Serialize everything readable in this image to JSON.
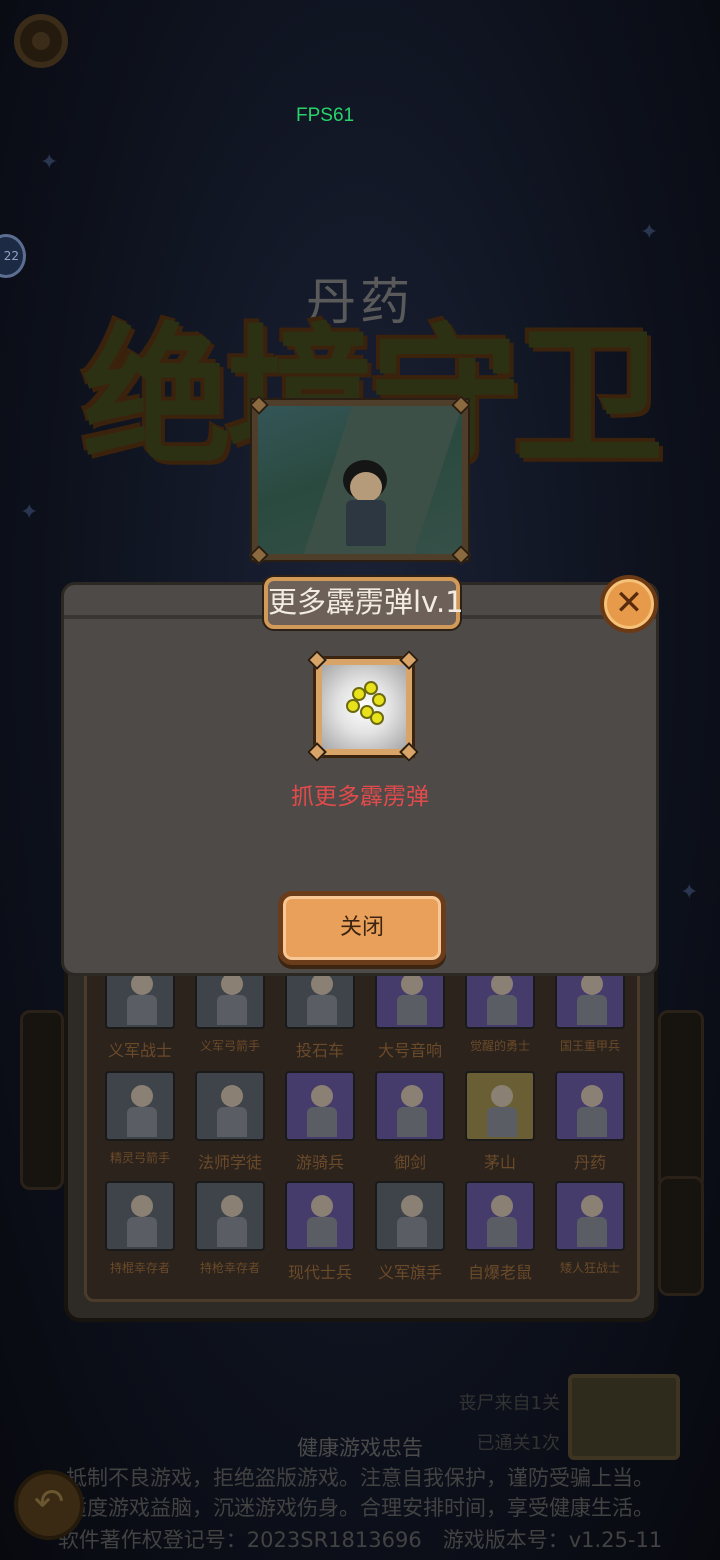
{
  "hud": {
    "fps": "FPS61",
    "side_badge": "22"
  },
  "background": {
    "hero_name": "丹药",
    "title_logo": "绝境守卫"
  },
  "dialog": {
    "title": "更多霹雳弹lv.1",
    "description": "抓更多霹雳弹",
    "close_button": "关闭",
    "close_icon": "close-icon",
    "item_icon": "thunder-bomb-icon"
  },
  "roster": {
    "rows": [
      [
        {
          "name": "义军战士",
          "size": "normal"
        },
        {
          "name": "义军弓箭手",
          "size": "small"
        },
        {
          "name": "投石车",
          "size": "normal"
        },
        {
          "name": "大号音响",
          "size": "normal"
        },
        {
          "name": "觉醒的勇士",
          "size": "small"
        },
        {
          "name": "国王重甲兵",
          "size": "small"
        }
      ],
      [
        {
          "name": "精灵弓箭手",
          "size": "small"
        },
        {
          "name": "法师学徒",
          "size": "normal"
        },
        {
          "name": "游骑兵",
          "size": "normal"
        },
        {
          "name": "御剑",
          "size": "normal"
        },
        {
          "name": "茅山",
          "size": "normal"
        },
        {
          "name": "丹药",
          "size": "normal"
        }
      ],
      [
        {
          "name": "持棍幸存者",
          "size": "small"
        },
        {
          "name": "持枪幸存者",
          "size": "small"
        },
        {
          "name": "现代士兵",
          "size": "normal"
        },
        {
          "name": "义军旗手",
          "size": "normal"
        },
        {
          "name": "自爆老鼠",
          "size": "normal"
        },
        {
          "name": "矮人狂战士",
          "size": "small"
        }
      ]
    ]
  },
  "stage": {
    "line1": "丧尸来自1关",
    "line2": "已通关1次"
  },
  "footer": {
    "title": "健康游戏忠告",
    "line1": "抵制不良游戏，拒绝盗版游戏。注意自我保护，谨防受骗上当。",
    "line2": "适度游戏益脑，沉迷游戏伤身。合理安排时间，享受健康生活。",
    "line3": "软件著作权登记号：2023SR1813696　游戏版本号：v1.25-11"
  },
  "colors": {
    "dialog_bg": "#4d4a48",
    "accent_orange": "#e9a05a",
    "desc_red": "#e24b4b",
    "fps_green": "#27d36a"
  }
}
